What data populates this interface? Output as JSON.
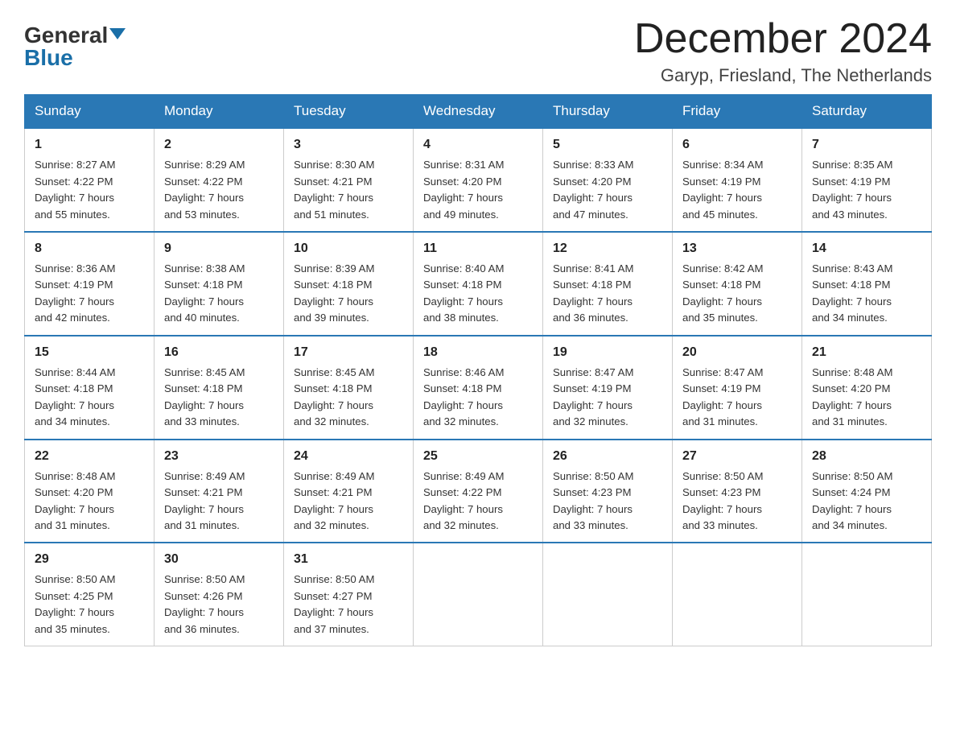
{
  "header": {
    "logo_general": "General",
    "logo_blue": "Blue",
    "month_title": "December 2024",
    "location": "Garyp, Friesland, The Netherlands"
  },
  "days_of_week": [
    "Sunday",
    "Monday",
    "Tuesday",
    "Wednesday",
    "Thursday",
    "Friday",
    "Saturday"
  ],
  "weeks": [
    [
      {
        "day": "1",
        "sunrise": "8:27 AM",
        "sunset": "4:22 PM",
        "daylight": "7 hours and 55 minutes."
      },
      {
        "day": "2",
        "sunrise": "8:29 AM",
        "sunset": "4:22 PM",
        "daylight": "7 hours and 53 minutes."
      },
      {
        "day": "3",
        "sunrise": "8:30 AM",
        "sunset": "4:21 PM",
        "daylight": "7 hours and 51 minutes."
      },
      {
        "day": "4",
        "sunrise": "8:31 AM",
        "sunset": "4:20 PM",
        "daylight": "7 hours and 49 minutes."
      },
      {
        "day": "5",
        "sunrise": "8:33 AM",
        "sunset": "4:20 PM",
        "daylight": "7 hours and 47 minutes."
      },
      {
        "day": "6",
        "sunrise": "8:34 AM",
        "sunset": "4:19 PM",
        "daylight": "7 hours and 45 minutes."
      },
      {
        "day": "7",
        "sunrise": "8:35 AM",
        "sunset": "4:19 PM",
        "daylight": "7 hours and 43 minutes."
      }
    ],
    [
      {
        "day": "8",
        "sunrise": "8:36 AM",
        "sunset": "4:19 PM",
        "daylight": "7 hours and 42 minutes."
      },
      {
        "day": "9",
        "sunrise": "8:38 AM",
        "sunset": "4:18 PM",
        "daylight": "7 hours and 40 minutes."
      },
      {
        "day": "10",
        "sunrise": "8:39 AM",
        "sunset": "4:18 PM",
        "daylight": "7 hours and 39 minutes."
      },
      {
        "day": "11",
        "sunrise": "8:40 AM",
        "sunset": "4:18 PM",
        "daylight": "7 hours and 38 minutes."
      },
      {
        "day": "12",
        "sunrise": "8:41 AM",
        "sunset": "4:18 PM",
        "daylight": "7 hours and 36 minutes."
      },
      {
        "day": "13",
        "sunrise": "8:42 AM",
        "sunset": "4:18 PM",
        "daylight": "7 hours and 35 minutes."
      },
      {
        "day": "14",
        "sunrise": "8:43 AM",
        "sunset": "4:18 PM",
        "daylight": "7 hours and 34 minutes."
      }
    ],
    [
      {
        "day": "15",
        "sunrise": "8:44 AM",
        "sunset": "4:18 PM",
        "daylight": "7 hours and 34 minutes."
      },
      {
        "day": "16",
        "sunrise": "8:45 AM",
        "sunset": "4:18 PM",
        "daylight": "7 hours and 33 minutes."
      },
      {
        "day": "17",
        "sunrise": "8:45 AM",
        "sunset": "4:18 PM",
        "daylight": "7 hours and 32 minutes."
      },
      {
        "day": "18",
        "sunrise": "8:46 AM",
        "sunset": "4:18 PM",
        "daylight": "7 hours and 32 minutes."
      },
      {
        "day": "19",
        "sunrise": "8:47 AM",
        "sunset": "4:19 PM",
        "daylight": "7 hours and 32 minutes."
      },
      {
        "day": "20",
        "sunrise": "8:47 AM",
        "sunset": "4:19 PM",
        "daylight": "7 hours and 31 minutes."
      },
      {
        "day": "21",
        "sunrise": "8:48 AM",
        "sunset": "4:20 PM",
        "daylight": "7 hours and 31 minutes."
      }
    ],
    [
      {
        "day": "22",
        "sunrise": "8:48 AM",
        "sunset": "4:20 PM",
        "daylight": "7 hours and 31 minutes."
      },
      {
        "day": "23",
        "sunrise": "8:49 AM",
        "sunset": "4:21 PM",
        "daylight": "7 hours and 31 minutes."
      },
      {
        "day": "24",
        "sunrise": "8:49 AM",
        "sunset": "4:21 PM",
        "daylight": "7 hours and 32 minutes."
      },
      {
        "day": "25",
        "sunrise": "8:49 AM",
        "sunset": "4:22 PM",
        "daylight": "7 hours and 32 minutes."
      },
      {
        "day": "26",
        "sunrise": "8:50 AM",
        "sunset": "4:23 PM",
        "daylight": "7 hours and 33 minutes."
      },
      {
        "day": "27",
        "sunrise": "8:50 AM",
        "sunset": "4:23 PM",
        "daylight": "7 hours and 33 minutes."
      },
      {
        "day": "28",
        "sunrise": "8:50 AM",
        "sunset": "4:24 PM",
        "daylight": "7 hours and 34 minutes."
      }
    ],
    [
      {
        "day": "29",
        "sunrise": "8:50 AM",
        "sunset": "4:25 PM",
        "daylight": "7 hours and 35 minutes."
      },
      {
        "day": "30",
        "sunrise": "8:50 AM",
        "sunset": "4:26 PM",
        "daylight": "7 hours and 36 minutes."
      },
      {
        "day": "31",
        "sunrise": "8:50 AM",
        "sunset": "4:27 PM",
        "daylight": "7 hours and 37 minutes."
      },
      null,
      null,
      null,
      null
    ]
  ],
  "labels": {
    "sunrise": "Sunrise:",
    "sunset": "Sunset:",
    "daylight": "Daylight:"
  }
}
